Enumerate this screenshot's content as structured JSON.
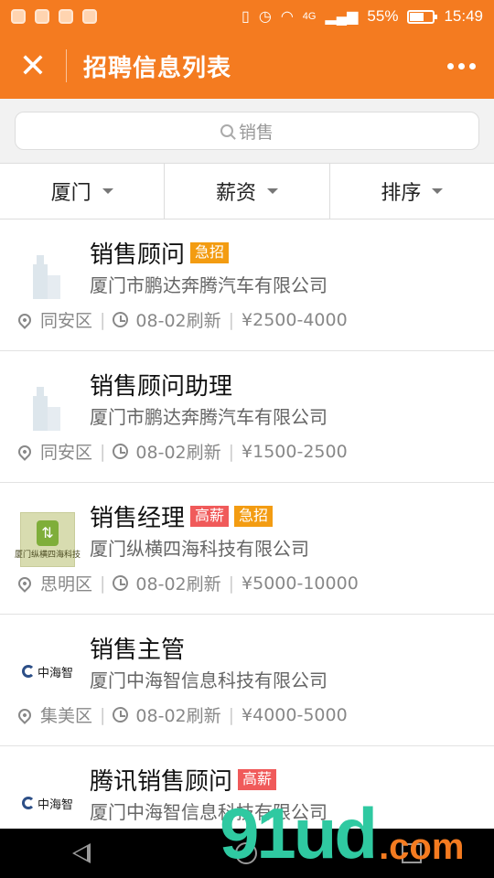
{
  "status_bar": {
    "signal_label": "4G",
    "battery": "55%",
    "time": "15:49"
  },
  "nav": {
    "title": "招聘信息列表"
  },
  "search": {
    "value": "销售"
  },
  "filters": [
    {
      "label": "厦门"
    },
    {
      "label": "薪资"
    },
    {
      "label": "排序"
    }
  ],
  "jobs": [
    {
      "title": "销售顾问",
      "tags": [
        "急招"
      ],
      "company": "厦门市鹏达奔腾汽车有限公司",
      "district": "同安区",
      "refresh": "08-02刷新",
      "salary": "¥2500-4000",
      "logo": "building-icon"
    },
    {
      "title": "销售顾问助理",
      "tags": [],
      "company": "厦门市鹏达奔腾汽车有限公司",
      "district": "同安区",
      "refresh": "08-02刷新",
      "salary": "¥1500-2500",
      "logo": "building-icon"
    },
    {
      "title": "销售经理",
      "tags": [
        "高薪",
        "急招"
      ],
      "company": "厦门纵横四海科技有限公司",
      "district": "思明区",
      "refresh": "08-02刷新",
      "salary": "¥5000-10000",
      "logo": "company-logo",
      "logo_text": "厦门纵横四海科技"
    },
    {
      "title": "销售主管",
      "tags": [],
      "company": "厦门中海智信息科技有限公司",
      "district": "集美区",
      "refresh": "08-02刷新",
      "salary": "¥4000-5000",
      "logo": "company-logo",
      "logo_text": "中海智"
    },
    {
      "title": "腾讯销售顾问",
      "tags": [
        "高薪"
      ],
      "company": "厦门中海智信息科技有限公司",
      "district": "",
      "refresh": "",
      "salary": "",
      "logo": "company-logo",
      "logo_text": "中海智"
    }
  ],
  "watermark": {
    "main": "91ud",
    "suffix": ".com"
  },
  "colors": {
    "brand": "#f47b20",
    "tag_urgent": "#f39c12",
    "tag_high_pay": "#f05a5a"
  }
}
